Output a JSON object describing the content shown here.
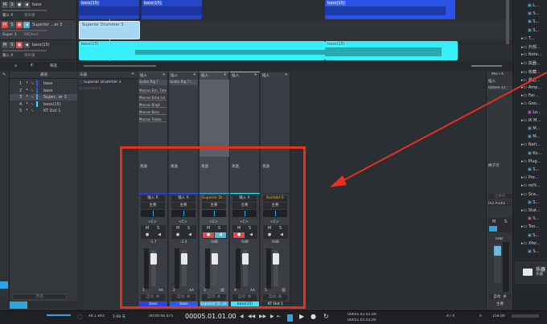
{
  "tracks": [
    {
      "name": "bass",
      "input": "输入 R",
      "mode": "单声道",
      "color": "#2f55e6",
      "muted": false,
      "rec": false
    },
    {
      "name": "Superior ...er 3",
      "input": "Super 3",
      "mode": "MIDIout",
      "color": "#8fd0f0",
      "muted": true,
      "rec": true
    },
    {
      "name": "bass(15)",
      "input": "输入 R",
      "mode": "单声道",
      "color": "#2de6f5",
      "muted": false,
      "rec": true
    }
  ],
  "clips": [
    {
      "label": "bass(15)"
    },
    {
      "label": "bass(15)"
    },
    {
      "label": "bass(15)"
    },
    {
      "label": "Superior Drummer 3"
    },
    {
      "label": "bass(15)"
    },
    {
      "label": "bass(15)"
    }
  ],
  "track_toolbar": {
    "label": "筛选"
  },
  "channel_list": {
    "header": "通道",
    "items": [
      {
        "num": "1",
        "name": "bass",
        "color": "#2f55e6"
      },
      {
        "num": "2",
        "name": "bass",
        "color": "#2f55e6"
      },
      {
        "num": "3",
        "name": "Super...er 3",
        "color": "#3fa8e0"
      },
      {
        "num": "4",
        "name": "bass(15)",
        "color": "#2de6f5"
      },
      {
        "num": "5",
        "name": "KT Out 1",
        "color": ""
      }
    ],
    "filter_placeholder": "筛选"
  },
  "instruments": {
    "header": "乐器",
    "items": [
      "Superior Drummer 3",
      "Kontakt 6"
    ]
  },
  "strips": [
    {
      "insert": "插入",
      "plugin": "Guitar Rig 7",
      "macros": [
        "Macros Ech..Time",
        "Macros Echo Lvl",
        "Macros Brigh",
        "Macros Bass",
        "Macros Treble"
      ],
      "send": "发送",
      "input": "输入 R",
      "output": "主要",
      "pan": "<C>",
      "volume": "-1.7",
      "num": "1",
      "auto": "自动: 关",
      "name": "bass",
      "color": "#2c3ff0",
      "input_orange": false,
      "rec": false,
      "mon": false
    },
    {
      "insert": "插入",
      "plugin": "Guitar Rig 7 (...",
      "macros": [],
      "send": "发送",
      "input": "输入 R",
      "output": "主要",
      "pan": "<C>",
      "volume": "-2.4",
      "num": "2",
      "auto": "自动: 关",
      "name": "bass",
      "color": "#2c5af0",
      "input_orange": false,
      "rec": false,
      "mon": false
    },
    {
      "insert": "插入",
      "plugin": "",
      "macros": [],
      "send": "发送",
      "input": "Superior Dr...er 3",
      "output": "主要",
      "pan": "<C>",
      "volume": "0dB",
      "num": "3",
      "auto": "自动: 关",
      "name": "Superior D...er 3",
      "color": "#3fa8e0",
      "input_orange": true,
      "rec": true,
      "mon": true
    },
    {
      "insert": "插入",
      "plugin": "",
      "macros": [],
      "send": "发送",
      "input": "输入 R",
      "output": "主要",
      "pan": "<C>",
      "volume": "0dB",
      "num": "4",
      "auto": "自动: 关",
      "name": "bass(15)",
      "color": "#36e8f4",
      "input_orange": false,
      "rec": true,
      "mon": false
    },
    {
      "insert": "插入",
      "plugin": "",
      "macros": [],
      "send": "发送",
      "input": "Kontakt 6",
      "output": "主要",
      "pan": "<C>",
      "volume": "0dB",
      "num": "5",
      "auto": "自动: 关",
      "name": "KT Out 1",
      "color": "#2b2e33",
      "input_orange": true,
      "rec": false,
      "mon": false
    }
  ],
  "main": {
    "title": "Mix FX",
    "insert": "插入",
    "plugin": "Ozone 11",
    "send": "换子页",
    "mode": "立体声",
    "output": "HD Audio ... + 2",
    "m": "M",
    "s": "S",
    "volume": "0dB",
    "auto": "自动: 关",
    "name": "主要"
  },
  "ms": {
    "m": "M",
    "s": "S"
  },
  "browser": {
    "items": [
      "L...",
      "S...",
      "S...",
      "S...",
      "T...",
      "外部...",
      "Note...",
      "执器...",
      "收藏...",
      "最近...",
      "Amp...",
      "Fac...",
      "Goo...",
      "Lo...",
      "IK M...",
      "M...",
      "M...",
      "Nati...",
      "Ko...",
      "Plug...",
      "S...",
      "Pre...",
      "refX...",
      "Sca...",
      "S...",
      "Stat...",
      "S...",
      "Too...",
      "S...",
      "Xfer...",
      "S..."
    ],
    "folder_title": "乐器",
    "folder_sub": "乐器"
  },
  "transport": {
    "sample_rate": "44.1 kHz",
    "duration": "1:08 天",
    "time": "00:00:06.075",
    "position": "00005.01.01.00",
    "loop_start": "00001.01.01.00",
    "loop_end": "00051.01.01.00",
    "signature": "4 / 4",
    "offset": "0",
    "tempo": "158.00"
  },
  "colors": {
    "highlight": "#e8301f",
    "accent": "#2fa4e0"
  }
}
